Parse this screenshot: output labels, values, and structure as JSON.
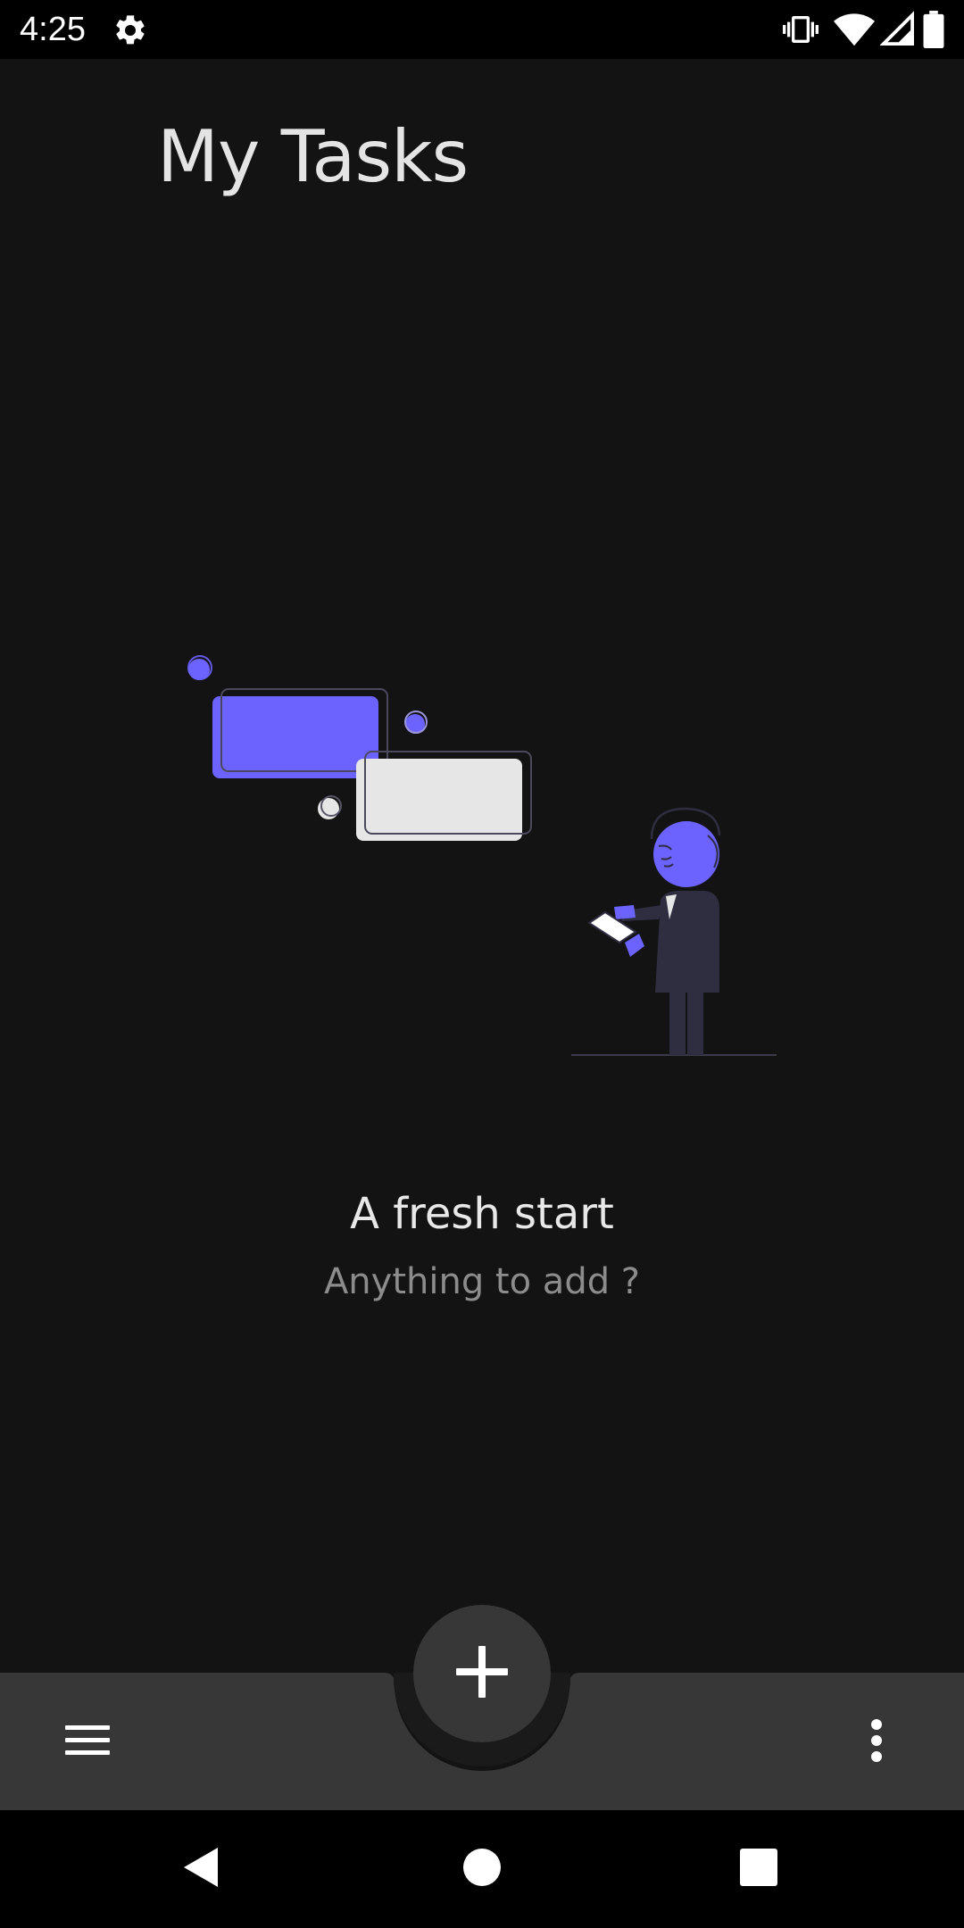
{
  "status_bar": {
    "time": "4:25",
    "icons": [
      "settings-icon",
      "vibrate-icon",
      "wifi-icon",
      "signal-icon",
      "battery-icon"
    ]
  },
  "header": {
    "title": "My Tasks"
  },
  "empty_state": {
    "title": "A fresh start",
    "subtitle": "Anything to add ?",
    "illustration": "person-with-tablet-and-task-cards"
  },
  "bottom_app_bar": {
    "left_icon": "menu-icon",
    "right_icon": "more-vert-icon",
    "fab_icon": "add-icon"
  },
  "nav_bar": {
    "icons": [
      "back-icon",
      "home-icon",
      "recents-icon"
    ]
  },
  "colors": {
    "accent": "#6c63ff",
    "background": "#131313",
    "bottom_bar": "#373737"
  }
}
